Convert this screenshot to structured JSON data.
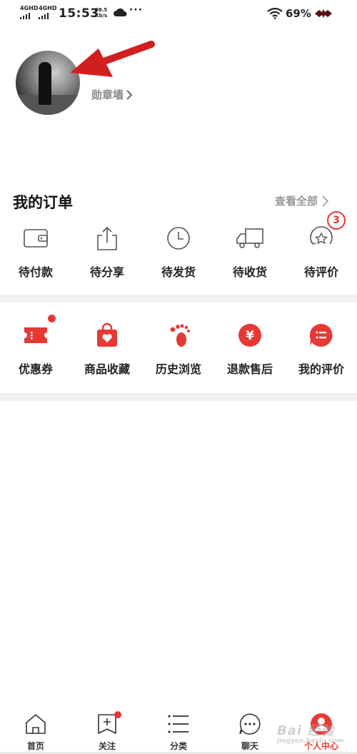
{
  "status_bar": {
    "sim1": "4GHD",
    "sim2": "4GHD",
    "time": "15:53",
    "speed_value": "98.5",
    "speed_unit": "Kb/s",
    "more": "···",
    "battery": "69%",
    "icons": [
      "signal-icon",
      "signal-icon",
      "weather-icon",
      "wifi-icon",
      "battery-icon"
    ]
  },
  "profile": {
    "medal_wall": "勋章墙",
    "avatar": "avatar-photo"
  },
  "orders": {
    "title": "我的订单",
    "view_all": "查看全部",
    "items": [
      {
        "label": "待付款",
        "icon": "wallet-icon"
      },
      {
        "label": "待分享",
        "icon": "share-icon"
      },
      {
        "label": "待发货",
        "icon": "clock-icon"
      },
      {
        "label": "待收货",
        "icon": "truck-icon"
      },
      {
        "label": "待评价",
        "icon": "review-icon",
        "badge": "3"
      }
    ]
  },
  "services": {
    "items": [
      {
        "label": "优惠券",
        "icon": "coupon-icon",
        "dot": true
      },
      {
        "label": "商品收藏",
        "icon": "favorite-bag-icon"
      },
      {
        "label": "历史浏览",
        "icon": "footprint-icon"
      },
      {
        "label": "退款售后",
        "icon": "refund-icon"
      },
      {
        "label": "我的评价",
        "icon": "my-review-icon"
      }
    ]
  },
  "tabbar": {
    "items": [
      {
        "label": "首页",
        "icon": "home-icon"
      },
      {
        "label": "关注",
        "icon": "follow-icon"
      },
      {
        "label": "分类",
        "icon": "category-icon"
      },
      {
        "label": "聊天",
        "icon": "chat-icon"
      },
      {
        "label": "个人中心",
        "icon": "profile-icon",
        "active": true
      }
    ]
  },
  "watermark": {
    "text": "Bai 经验",
    "sub": "jingyan.baidu.com"
  },
  "colors": {
    "accent": "#e53935",
    "text": "#222222",
    "muted": "#999999",
    "divider": "#f1f1f1"
  }
}
